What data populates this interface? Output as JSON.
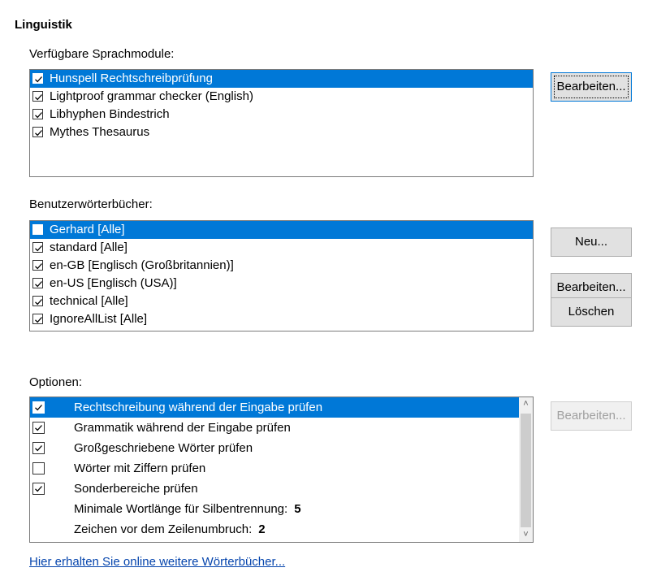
{
  "section_title": "Linguistik",
  "modules": {
    "label": "Verfügbare Sprachmodule:",
    "items": [
      {
        "label": "Hunspell Rechtschreibprüfung",
        "checked": true,
        "selected": true
      },
      {
        "label": "Lightproof grammar checker (English)",
        "checked": true,
        "selected": false
      },
      {
        "label": "Libhyphen Bindestrich",
        "checked": true,
        "selected": false
      },
      {
        "label": "Mythes Thesaurus",
        "checked": true,
        "selected": false
      }
    ],
    "edit_button": "Bearbeiten..."
  },
  "dictionaries": {
    "label": "Benutzerwörterbücher:",
    "items": [
      {
        "label": "Gerhard [Alle]",
        "checked": false,
        "selected": true
      },
      {
        "label": "standard [Alle]",
        "checked": true,
        "selected": false
      },
      {
        "label": "en-GB [Englisch (Großbritannien)]",
        "checked": true,
        "selected": false
      },
      {
        "label": "en-US [Englisch (USA)]",
        "checked": true,
        "selected": false
      },
      {
        "label": "technical [Alle]",
        "checked": true,
        "selected": false
      },
      {
        "label": "IgnoreAllList [Alle]",
        "checked": true,
        "selected": false
      }
    ],
    "new_button": "Neu...",
    "edit_button": "Bearbeiten...",
    "delete_button": "Löschen"
  },
  "options": {
    "label": "Optionen:",
    "items": [
      {
        "label": "Rechtschreibung während der Eingabe prüfen",
        "checked": true,
        "selected": true,
        "has_checkbox": true
      },
      {
        "label": "Grammatik während der Eingabe prüfen",
        "checked": true,
        "selected": false,
        "has_checkbox": true
      },
      {
        "label": "Großgeschriebene Wörter prüfen",
        "checked": true,
        "selected": false,
        "has_checkbox": true
      },
      {
        "label": "Wörter mit Ziffern prüfen",
        "checked": false,
        "selected": false,
        "has_checkbox": true
      },
      {
        "label": "Sonderbereiche prüfen",
        "checked": true,
        "selected": false,
        "has_checkbox": true
      },
      {
        "label": "Minimale Wortlänge für Silbentrennung:",
        "value": "5",
        "has_checkbox": false
      },
      {
        "label": "Zeichen vor dem Zeilenumbruch:",
        "value": "2",
        "has_checkbox": false
      }
    ],
    "edit_button": "Bearbeiten..."
  },
  "link_text": "Hier erhalten Sie online weitere Wörterbücher...",
  "colors": {
    "selection": "#0078d7",
    "link": "#0645ad"
  }
}
